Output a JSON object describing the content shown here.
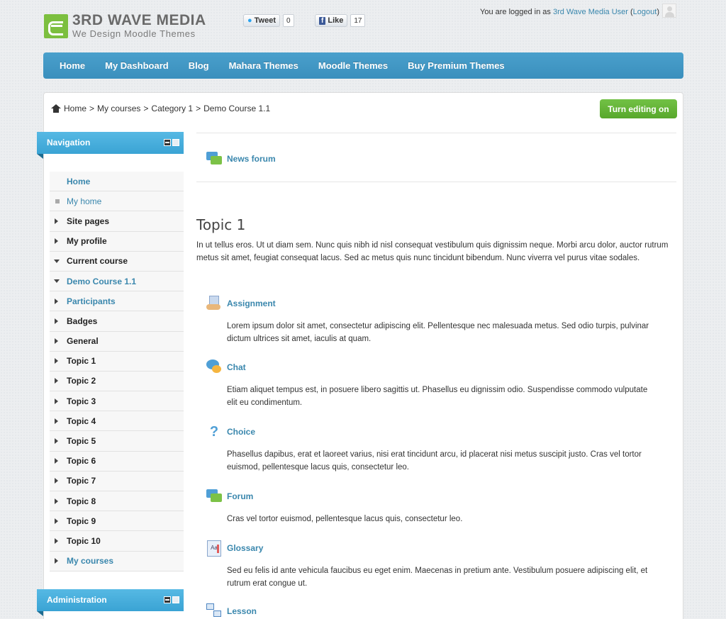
{
  "header": {
    "logo_title": "3RD WAVE MEDIA",
    "logo_subtitle": "We Design Moodle Themes",
    "tweet_label": "Tweet",
    "tweet_count": "0",
    "like_label": "Like",
    "like_count": "17",
    "logged_in_prefix": "You are logged in as",
    "user_name": "3rd Wave Media User",
    "logout_label": "Logout"
  },
  "navbar": {
    "items": [
      "Home",
      "My Dashboard",
      "Blog",
      "Mahara Themes",
      "Moodle Themes",
      "Buy Premium Themes"
    ]
  },
  "breadcrumb": {
    "items": [
      "Home",
      "My courses",
      "Category 1",
      "Demo Course 1.1"
    ],
    "separator": ">"
  },
  "edit_button": "Turn editing on",
  "navigation_block": {
    "title": "Navigation",
    "items": [
      {
        "label": "Home",
        "icon": "none"
      },
      {
        "label": "My home",
        "icon": "square-bullet-icon"
      },
      {
        "label": "Site pages",
        "icon": "expand-right-icon"
      },
      {
        "label": "My profile",
        "icon": "expand-right-icon"
      },
      {
        "label": "Current course",
        "icon": "expand-down-icon"
      },
      {
        "label": "Demo Course 1.1",
        "icon": "expand-down-icon"
      },
      {
        "label": "Participants",
        "icon": "expand-right-icon"
      },
      {
        "label": "Badges",
        "icon": "expand-right-icon"
      },
      {
        "label": "General",
        "icon": "expand-right-icon"
      },
      {
        "label": "Topic 1",
        "icon": "expand-right-icon"
      },
      {
        "label": "Topic 2",
        "icon": "expand-right-icon"
      },
      {
        "label": "Topic 3",
        "icon": "expand-right-icon"
      },
      {
        "label": "Topic 4",
        "icon": "expand-right-icon"
      },
      {
        "label": "Topic 5",
        "icon": "expand-right-icon"
      },
      {
        "label": "Topic 6",
        "icon": "expand-right-icon"
      },
      {
        "label": "Topic 7",
        "icon": "expand-right-icon"
      },
      {
        "label": "Topic 8",
        "icon": "expand-right-icon"
      },
      {
        "label": "Topic 9",
        "icon": "expand-right-icon"
      },
      {
        "label": "Topic 10",
        "icon": "expand-right-icon"
      },
      {
        "label": "My courses",
        "icon": "expand-right-icon"
      }
    ]
  },
  "administration_block": {
    "title": "Administration"
  },
  "main": {
    "news_forum": "News forum",
    "topic_title": "Topic 1",
    "topic_summary": "In ut tellus eros. Ut ut diam sem. Nunc quis nibh id nisl consequat vestibulum quis dignissim neque. Morbi arcu dolor, auctor rutrum metus sit amet, feugiat consequat lacus. Sed ac metus quis nunc tincidunt bibendum. Nunc viverra vel purus vitae sodales.",
    "activities": [
      {
        "name": "Assignment",
        "icon": "assignment-icon",
        "description": "Lorem ipsum dolor sit amet, consectetur adipiscing elit. Pellentesque nec malesuada metus. Sed odio turpis, pulvinar dictum ultrices sit amet, iaculis at quam."
      },
      {
        "name": "Chat",
        "icon": "chat-icon",
        "description": "Etiam aliquet tempus est, in posuere libero sagittis ut. Phasellus eu dignissim odio. Suspendisse commodo vulputate elit eu condimentum."
      },
      {
        "name": "Choice",
        "icon": "choice-icon",
        "description": "Phasellus dapibus, erat et laoreet varius, nisi erat tincidunt arcu, id placerat nisi metus suscipit justo. Cras vel tortor euismod, pellentesque lacus quis, consectetur leo."
      },
      {
        "name": "Forum",
        "icon": "forum-icon",
        "description": "Cras vel tortor euismod, pellentesque lacus quis, consectetur leo."
      },
      {
        "name": "Glossary",
        "icon": "glossary-icon",
        "description": "Sed eu felis id ante vehicula faucibus eu eget enim. Maecenas in pretium ante. Vestibulum posuere adipiscing elit, et rutrum erat congue ut."
      },
      {
        "name": "Lesson",
        "icon": "lesson-icon",
        "description": ""
      }
    ]
  }
}
